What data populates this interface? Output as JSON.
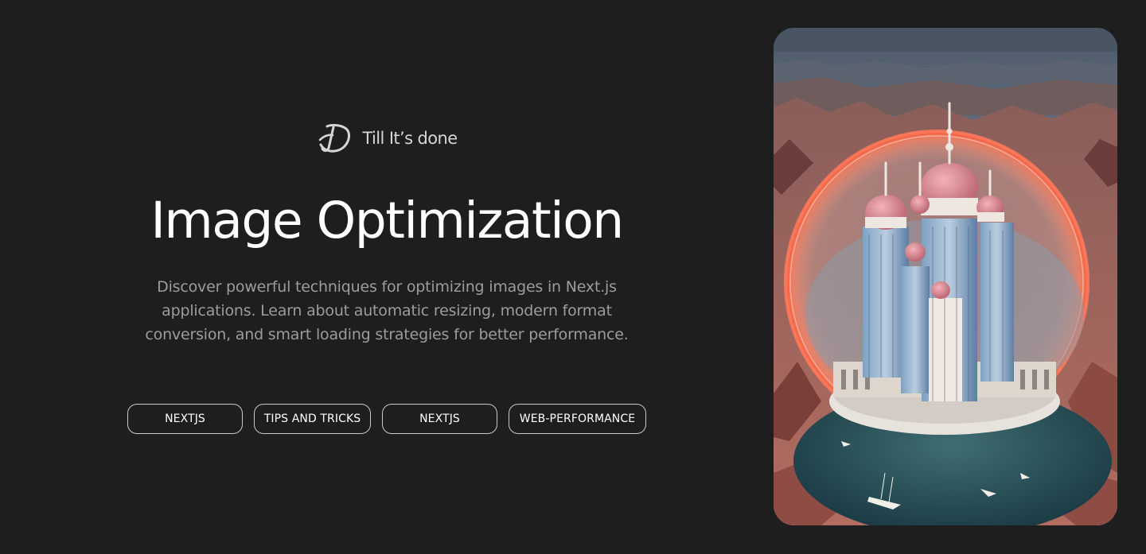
{
  "brand": {
    "name": "Till It’s done",
    "logo_icon": "td-monogram-icon"
  },
  "hero": {
    "title": "Image Optimization",
    "description": "Discover powerful techniques for optimizing images in Next.js applications. Learn about automatic resizing, modern format conversion, and smart loading strategies for better performance."
  },
  "tags": [
    {
      "label": "NEXTJS"
    },
    {
      "label": "TIPS AND TRICKS"
    },
    {
      "label": "NEXTJS"
    },
    {
      "label": "WEB-PERFORMANCE"
    }
  ],
  "image": {
    "subject": "fantasy-palace-in-glowing-sphere"
  },
  "colors": {
    "background": "#1e1e1e",
    "title": "#ffffff",
    "description": "#9c9c9c",
    "tag_border": "#c9c9c9"
  }
}
